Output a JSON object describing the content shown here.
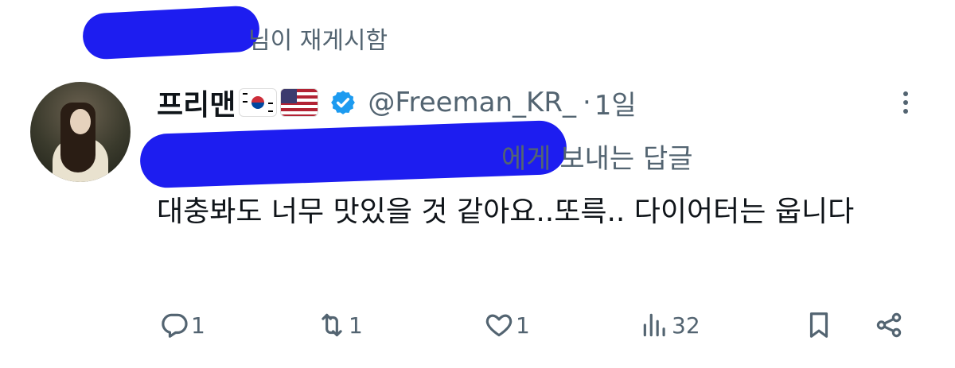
{
  "repost": {
    "suffix": "님이 재게시함"
  },
  "author": {
    "name": "프리맨",
    "flags": [
      "south-korea-flag",
      "usa-flag"
    ],
    "verified": true,
    "handle": "@Freeman_KR_",
    "separator": "·",
    "time": "1일"
  },
  "reply_context": {
    "suffix": "에게 보내는 답글"
  },
  "tweet": {
    "text": "대충봐도 너무 맛있을 것 같아요..또륵.. 다이어터는 웁니다"
  },
  "actions": {
    "reply_count": "1",
    "repost_count": "1",
    "like_count": "1",
    "views_count": "32"
  },
  "colors": {
    "accent": "#1d9bf0",
    "muted": "#536471",
    "text": "#0f1419",
    "redaction": "#1d1df0"
  }
}
